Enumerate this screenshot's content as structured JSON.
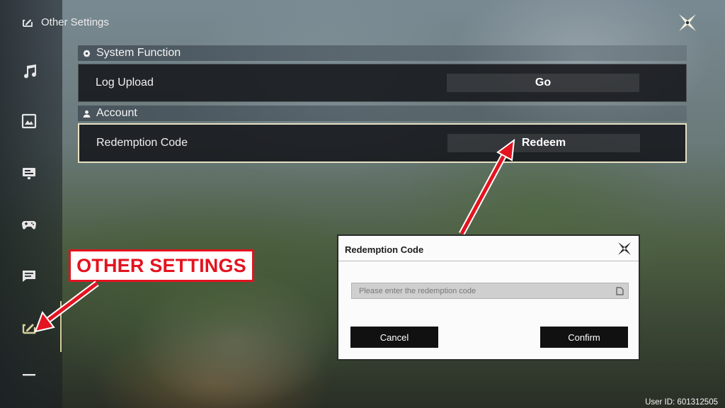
{
  "header": {
    "title": "Other Settings"
  },
  "sections": [
    {
      "title": "System Function",
      "rows": [
        {
          "label": "Log Upload",
          "button": "Go"
        }
      ]
    },
    {
      "title": "Account",
      "rows": [
        {
          "label": "Redemption Code",
          "button": "Redeem"
        }
      ]
    }
  ],
  "sidebar": {
    "items": [
      {
        "icon": "music-icon"
      },
      {
        "icon": "display-icon"
      },
      {
        "icon": "monitor-icon"
      },
      {
        "icon": "gamepad-icon"
      },
      {
        "icon": "chat-icon"
      },
      {
        "icon": "other-settings-icon",
        "active": true
      },
      {
        "icon": "more-icon"
      }
    ],
    "accent_color": "#d8cf9a"
  },
  "dialog": {
    "title": "Redemption Code",
    "input_placeholder": "Please enter the redemption code",
    "input_value": "",
    "cancel_label": "Cancel",
    "confirm_label": "Confirm"
  },
  "annotation": {
    "label": "OTHER SETTINGS",
    "color": "#e3131f"
  },
  "footer": {
    "user_id": "User ID: 601312505"
  }
}
